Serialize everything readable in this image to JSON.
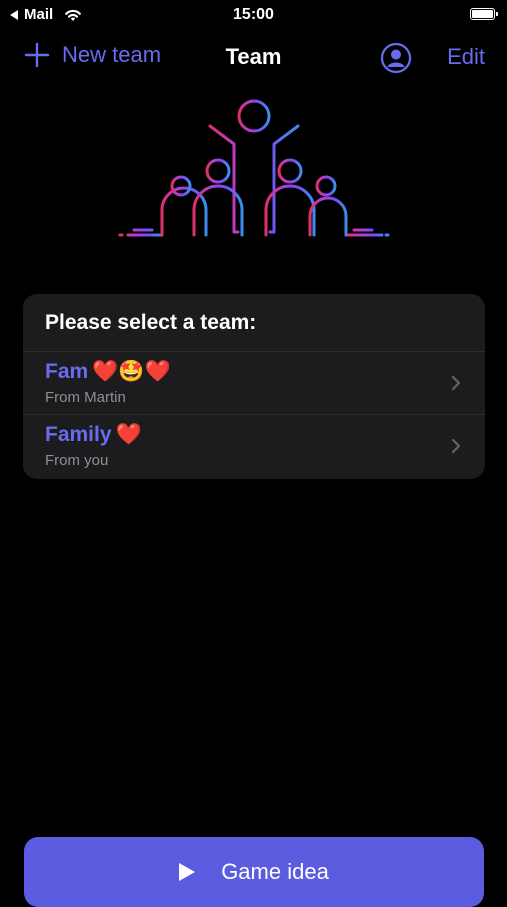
{
  "status_bar": {
    "back_app": "Mail",
    "time": "15:00"
  },
  "nav": {
    "new_team_label": "New team",
    "title": "Team",
    "edit_label": "Edit",
    "icons": [
      "plus-icon",
      "profile-icon"
    ]
  },
  "card": {
    "header": "Please select a team:",
    "teams": [
      {
        "name": "Fam",
        "emoji": "❤️🤩❤️",
        "subtitle": "From Martin"
      },
      {
        "name": "Family",
        "emoji": "❤️",
        "subtitle": "From you"
      }
    ]
  },
  "cta": {
    "label": "Game idea"
  },
  "colors": {
    "accent": "#6a6cf0",
    "cta_bg": "#5c5ce0",
    "card_bg": "#1c1c1e",
    "subtitle": "#8e8e93"
  }
}
